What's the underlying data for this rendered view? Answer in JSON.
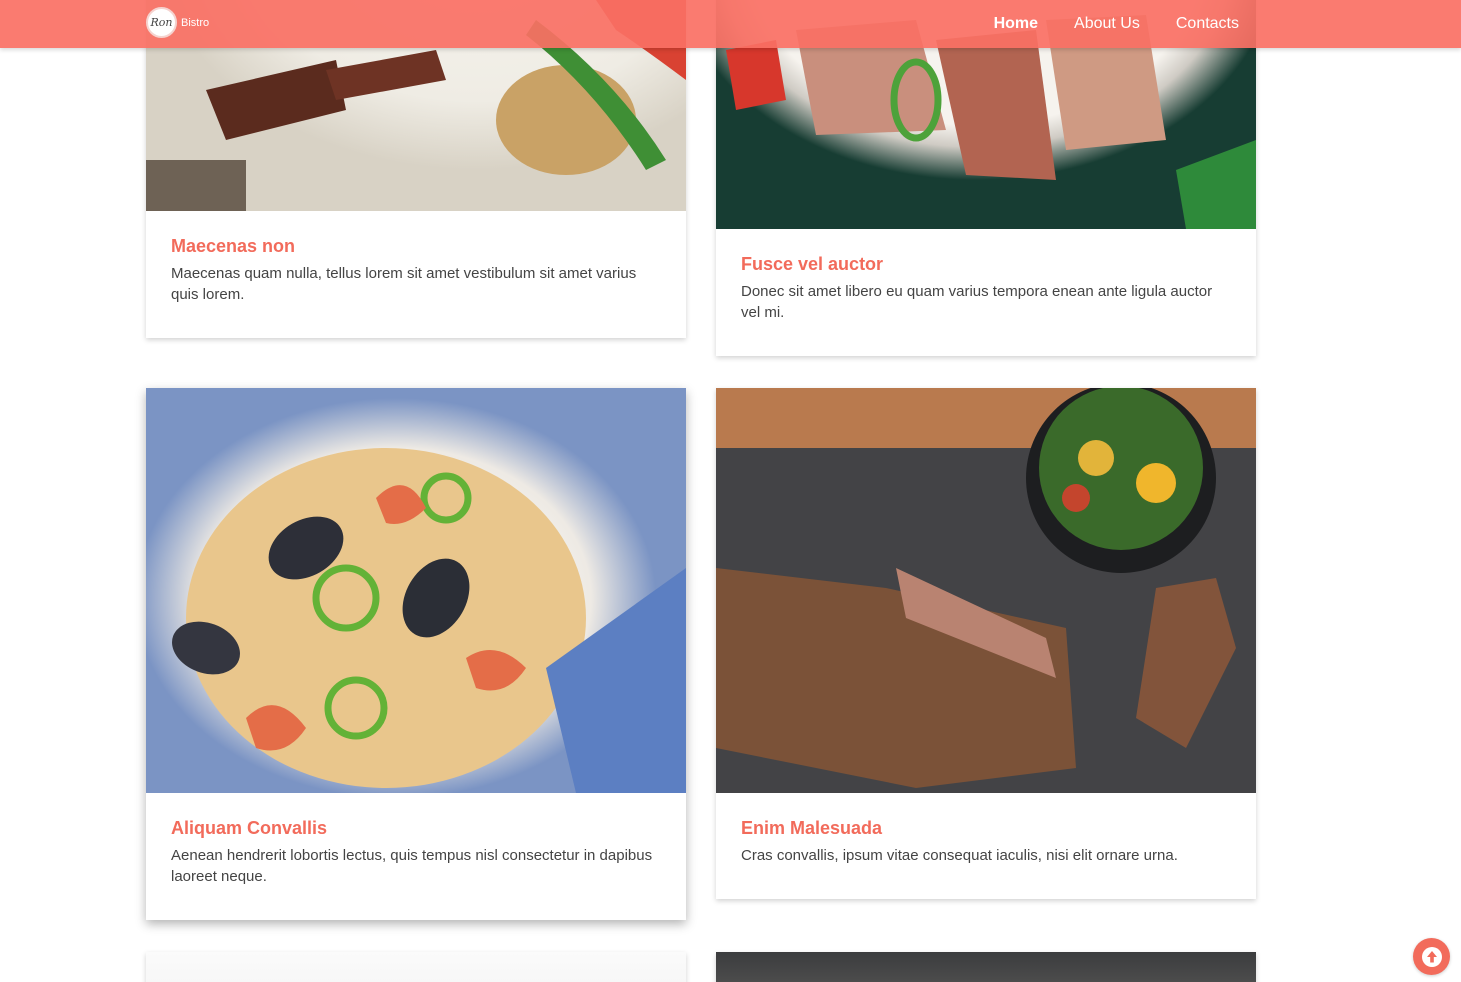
{
  "header": {
    "logo_mark": "Ron",
    "logo_text": "Bistro",
    "nav": [
      {
        "label": "Home",
        "active": true
      },
      {
        "label": "About Us",
        "active": false
      },
      {
        "label": "Contacts",
        "active": false
      }
    ],
    "bg_color": "#fa7064"
  },
  "cards": [
    {
      "title": "Maecenas non",
      "text": "Maecenas quam nulla, tellus lorem sit amet vestibulum sit amet varius quis lorem."
    },
    {
      "title": "Fusce vel auctor",
      "text": "Donec sit amet libero eu quam varius tempora enean ante ligula auctor vel mi."
    },
    {
      "title": "Aliquam Convallis",
      "text": "Aenean hendrerit lobortis lectus, quis tempus nisl consectetur in dapibus laoreet neque."
    },
    {
      "title": "Enim Malesuada",
      "text": "Cras convallis, ipsum vitae consequat iaculis, nisi elit ornare urna."
    }
  ],
  "accent_color": "#f26b5b",
  "icons": {
    "scroll_top": "arrow-up-circle-icon"
  }
}
